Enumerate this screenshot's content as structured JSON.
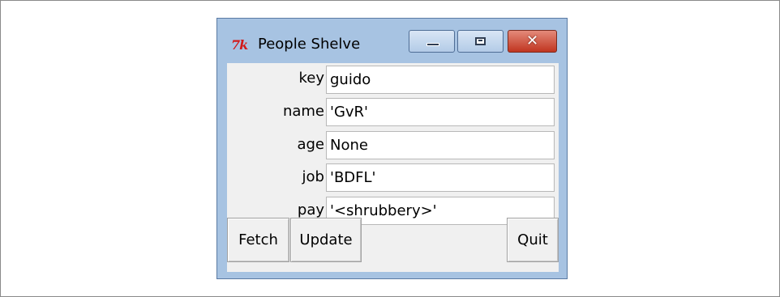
{
  "window": {
    "title": "People Shelve",
    "icon_name": "tk-icon",
    "icon_text": "7k",
    "controls": {
      "minimize": "minimize-icon",
      "maximize": "maximize-icon",
      "close": "close-icon",
      "close_glyph": "✕"
    }
  },
  "form": {
    "fields": [
      {
        "label": "key",
        "value": "guido"
      },
      {
        "label": "name",
        "value": "'GvR'"
      },
      {
        "label": "age",
        "value": "None"
      },
      {
        "label": "job",
        "value": "'BDFL'"
      },
      {
        "label": "pay",
        "value": "'<shrubbery>'"
      }
    ]
  },
  "buttons": {
    "fetch": "Fetch",
    "update": "Update",
    "quit": "Quit"
  }
}
